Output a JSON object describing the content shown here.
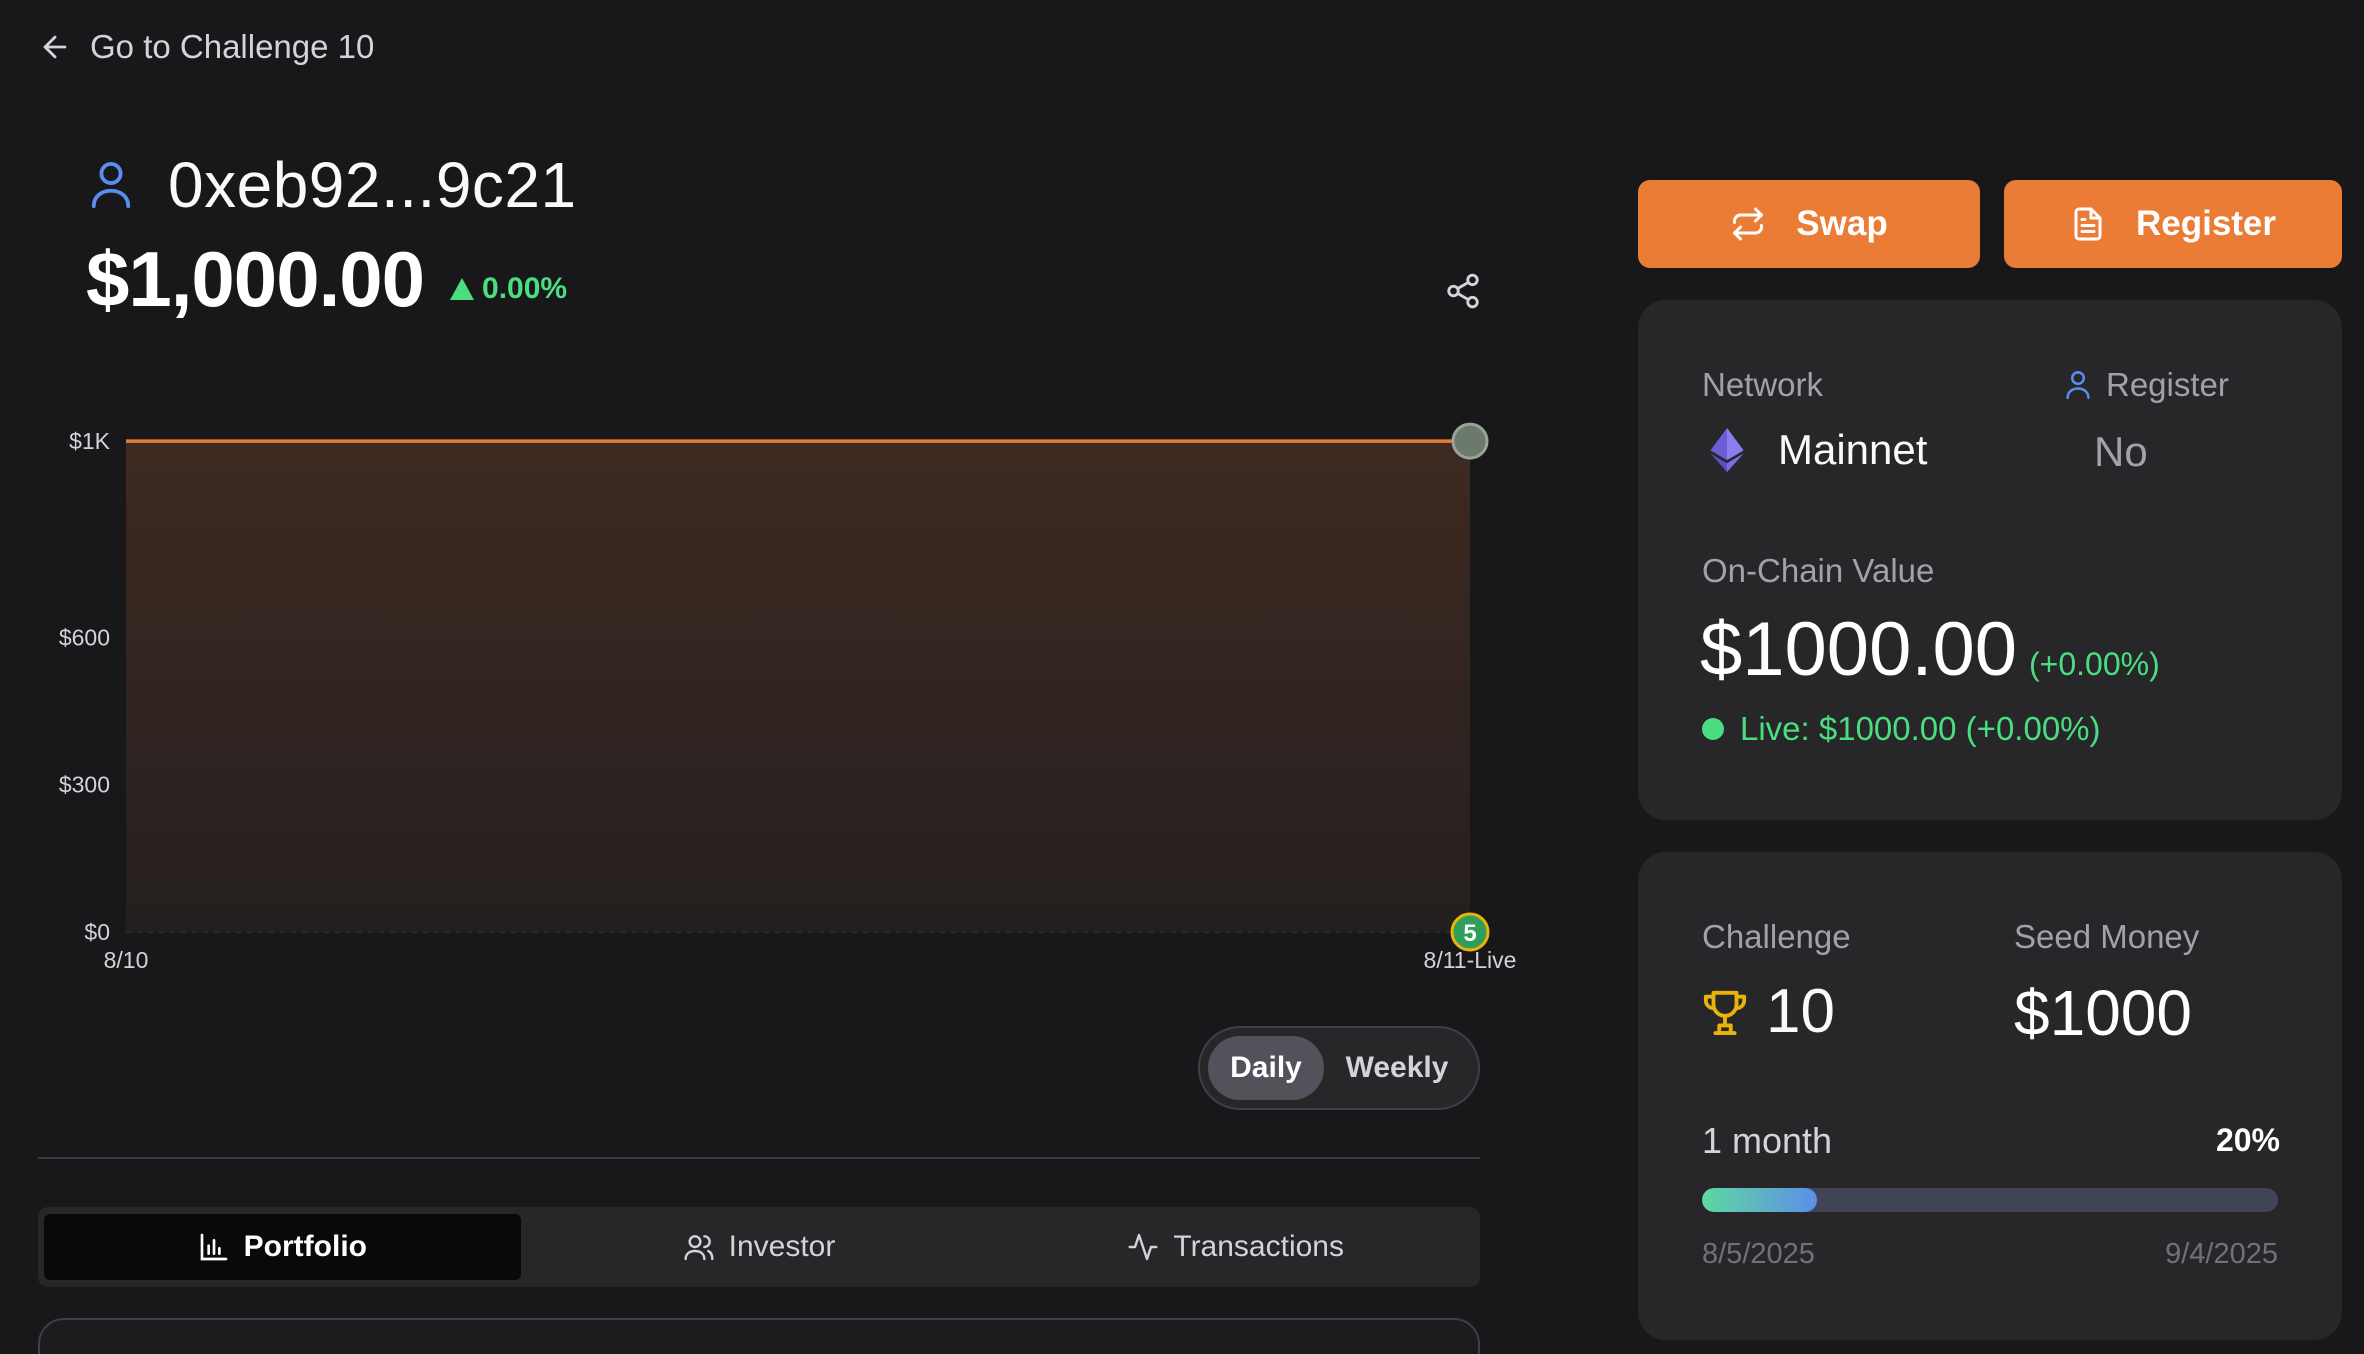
{
  "nav": {
    "back_label": "Go to Challenge 10"
  },
  "header": {
    "address": "0xeb92...9c21",
    "balance": "$1,000.00",
    "change": "0.00%"
  },
  "chart_data": {
    "type": "area",
    "y_ticks": [
      "$1K",
      "$600",
      "$300",
      "$0"
    ],
    "x_ticks": [
      "8/10",
      "8/11-Live"
    ],
    "x": [
      "8/10",
      "8/11-Live"
    ],
    "series": [
      {
        "values": [
          1000,
          1000
        ]
      }
    ],
    "ylim": [
      0,
      1100
    ],
    "end_marker_label": "5",
    "colors": {
      "line": "#ea7c35",
      "fill": "#3b2a22"
    }
  },
  "toggle": {
    "daily": "Daily",
    "weekly": "Weekly",
    "selected": "Daily"
  },
  "tabs": [
    {
      "label": "Portfolio",
      "icon": "bar-chart-icon",
      "active": true
    },
    {
      "label": "Investor",
      "icon": "users-icon",
      "active": false
    },
    {
      "label": "Transactions",
      "icon": "activity-icon",
      "active": false
    }
  ],
  "actions": {
    "swap": "Swap",
    "register": "Register"
  },
  "network_card": {
    "network_label": "Network",
    "network_value": "Mainnet",
    "register_label": "Register",
    "register_value": "No",
    "onchain_label": "On-Chain Value",
    "onchain_value": "$1000.00",
    "onchain_change": "(+0.00%)",
    "live_text": "Live: $1000.00 (+0.00%)"
  },
  "challenge_card": {
    "challenge_label": "Challenge",
    "challenge_value": "10",
    "seed_label": "Seed Money",
    "seed_value": "$1000",
    "period": "1 month",
    "progress_pct": "20%",
    "progress": 0.2,
    "start_date": "8/5/2025",
    "end_date": "9/4/2025"
  },
  "colors": {
    "accent": "#ea7c35",
    "positive": "#4ade80",
    "background": "#18181b",
    "card": "#27272a"
  }
}
